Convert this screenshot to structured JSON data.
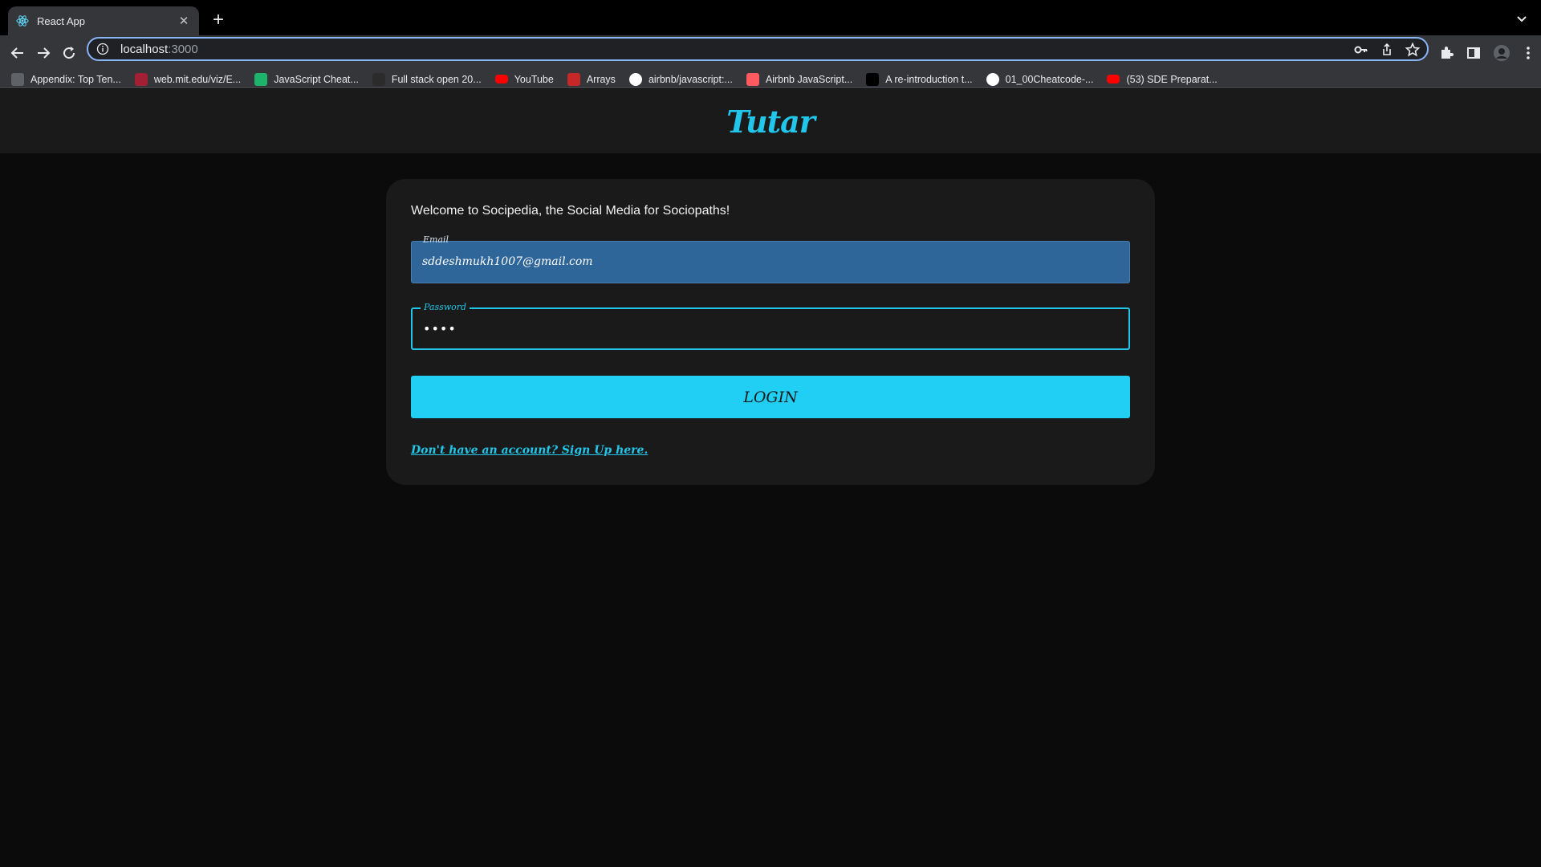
{
  "browser": {
    "tab": {
      "title": "React App",
      "favicon": "react-icon"
    },
    "url": {
      "host": "localhost",
      "port": ":3000"
    },
    "bookmarks": [
      {
        "label": "Appendix: Top Ten...",
        "icon": "page-icon",
        "color": "#5f6368"
      },
      {
        "label": "web.mit.edu/viz/E...",
        "icon": "mit-icon",
        "color": "#a31f34"
      },
      {
        "label": "JavaScript Cheat...",
        "icon": "cheat-icon",
        "color": "#1db36b"
      },
      {
        "label": "Full stack open 20...",
        "icon": "fullstack-icon",
        "color": "#2b2b2b"
      },
      {
        "label": "YouTube",
        "icon": "youtube-icon",
        "color": "#ff0000"
      },
      {
        "label": "Arrays",
        "icon": "arrays-icon",
        "color": "#c62828"
      },
      {
        "label": "airbnb/javascript:...",
        "icon": "github-icon",
        "color": "#ffffff"
      },
      {
        "label": "Airbnb JavaScript...",
        "icon": "airbnb-icon",
        "color": "#ff5a5f"
      },
      {
        "label": "A re-introduction t...",
        "icon": "mdn-icon",
        "color": "#000000"
      },
      {
        "label": "01_00Cheatcode-...",
        "icon": "globe-icon",
        "color": "#ffffff"
      },
      {
        "label": "(53) SDE Preparat...",
        "icon": "youtube-icon",
        "color": "#ff0000"
      }
    ]
  },
  "app": {
    "brand": "Tutar",
    "welcome": "Welcome to Socipedia, the Social Media for Sociopaths!",
    "email": {
      "label": "Email",
      "value": "sddeshmukh1007@gmail.com"
    },
    "password": {
      "label": "Password",
      "value": "••••"
    },
    "login_label": "LOGIN",
    "signup_link": "Don't have an account? Sign Up here."
  },
  "colors": {
    "accent": "#22c6ea",
    "button": "#22cff4",
    "email_autofill": "#2f6699",
    "card": "#1a1a1a",
    "page": "#0b0b0b"
  }
}
